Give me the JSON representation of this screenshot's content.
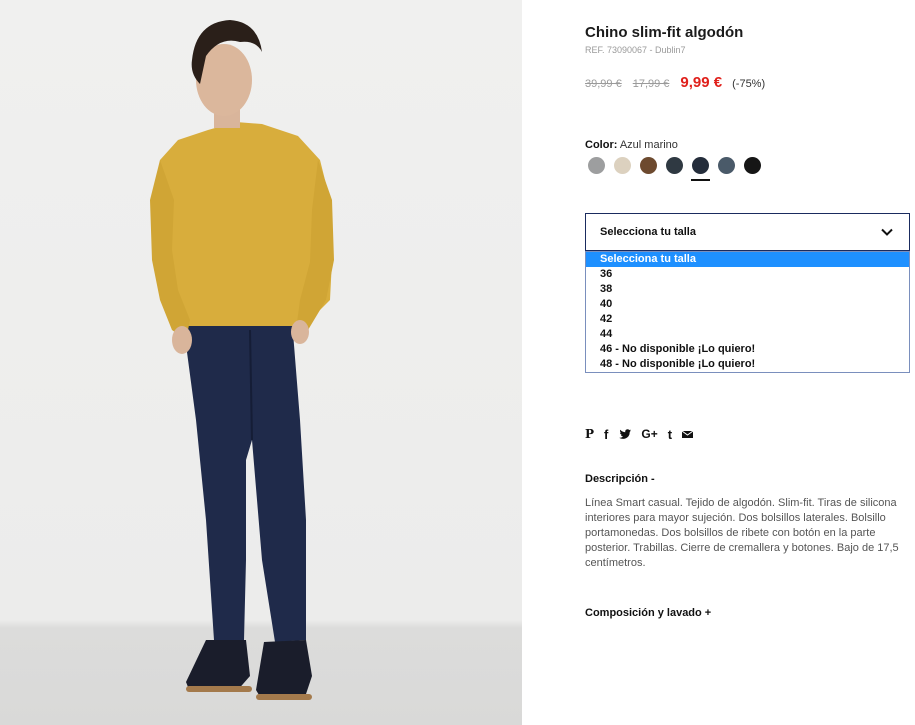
{
  "product": {
    "title": "Chino slim-fit algodón",
    "ref": "REF. 73090067 - Dublin7",
    "price_original": "39,99 €",
    "price_previous": "17,99 €",
    "price_sale": "9,99 €",
    "discount": "(-75%)"
  },
  "color": {
    "label": "Color:",
    "value": "Azul marino",
    "swatches": [
      "#9d9e9f",
      "#dcd1bf",
      "#6d4a2f",
      "#2f3942",
      "#242d3b",
      "#4a5a69",
      "#161616"
    ],
    "selected_index": 4
  },
  "size": {
    "placeholder": "Selecciona tu talla",
    "options": [
      "Selecciona tu talla",
      "36",
      "38",
      "40",
      "42",
      "44",
      "46 - No disponible ¡Lo quiero!",
      "48 - No disponible ¡Lo quiero!"
    ],
    "highlighted_index": 0
  },
  "social": {
    "pinterest": "P",
    "facebook": "f",
    "google_plus": "G+",
    "tumblr": "t"
  },
  "description": {
    "heading": "Descripción -",
    "text": "Línea Smart casual. Tejido de algodón. Slim-fit. Tiras de silicona interiores para mayor sujeción. Dos bolsillos laterales. Bolsillo portamonedas. Dos bolsillos de ribete con botón en la parte posterior. Trabillas. Cierre de cremallera y botones. Bajo de 17,5 centímetros."
  },
  "composition": {
    "heading": "Composición y lavado +"
  },
  "colors": {
    "sale": "#e0201b",
    "highlight": "#1e90ff",
    "select_border": "#1a2b5e"
  }
}
